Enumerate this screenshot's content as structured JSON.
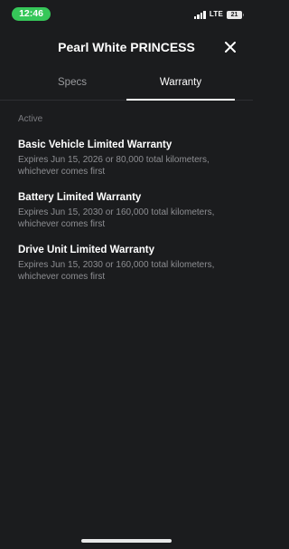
{
  "status_bar": {
    "time": "12:46",
    "network": "LTE",
    "battery": "21",
    "time_pill_color": "#36c759",
    "signal_icon": "cellular-signal-icon",
    "battery_icon": "battery-icon"
  },
  "header": {
    "title": "Pearl White PRINCESS",
    "close_icon": "close-icon"
  },
  "tabs": [
    {
      "label": "Specs",
      "active": false
    },
    {
      "label": "Warranty",
      "active": true
    }
  ],
  "section": {
    "label": "Active"
  },
  "warranties": [
    {
      "title": "Basic Vehicle Limited Warranty",
      "description": "Expires Jun 15, 2026 or 80,000 total kilometers, whichever comes first"
    },
    {
      "title": "Battery Limited Warranty",
      "description": "Expires Jun 15, 2030 or 160,000 total kilometers, whichever comes first"
    },
    {
      "title": "Drive Unit Limited Warranty",
      "description": "Expires Jun 15, 2030 or 160,000 total kilometers, whichever comes first"
    }
  ],
  "colors": {
    "background": "#1b1c1e",
    "text_primary": "#ffffff",
    "text_secondary": "#8d8e92"
  }
}
